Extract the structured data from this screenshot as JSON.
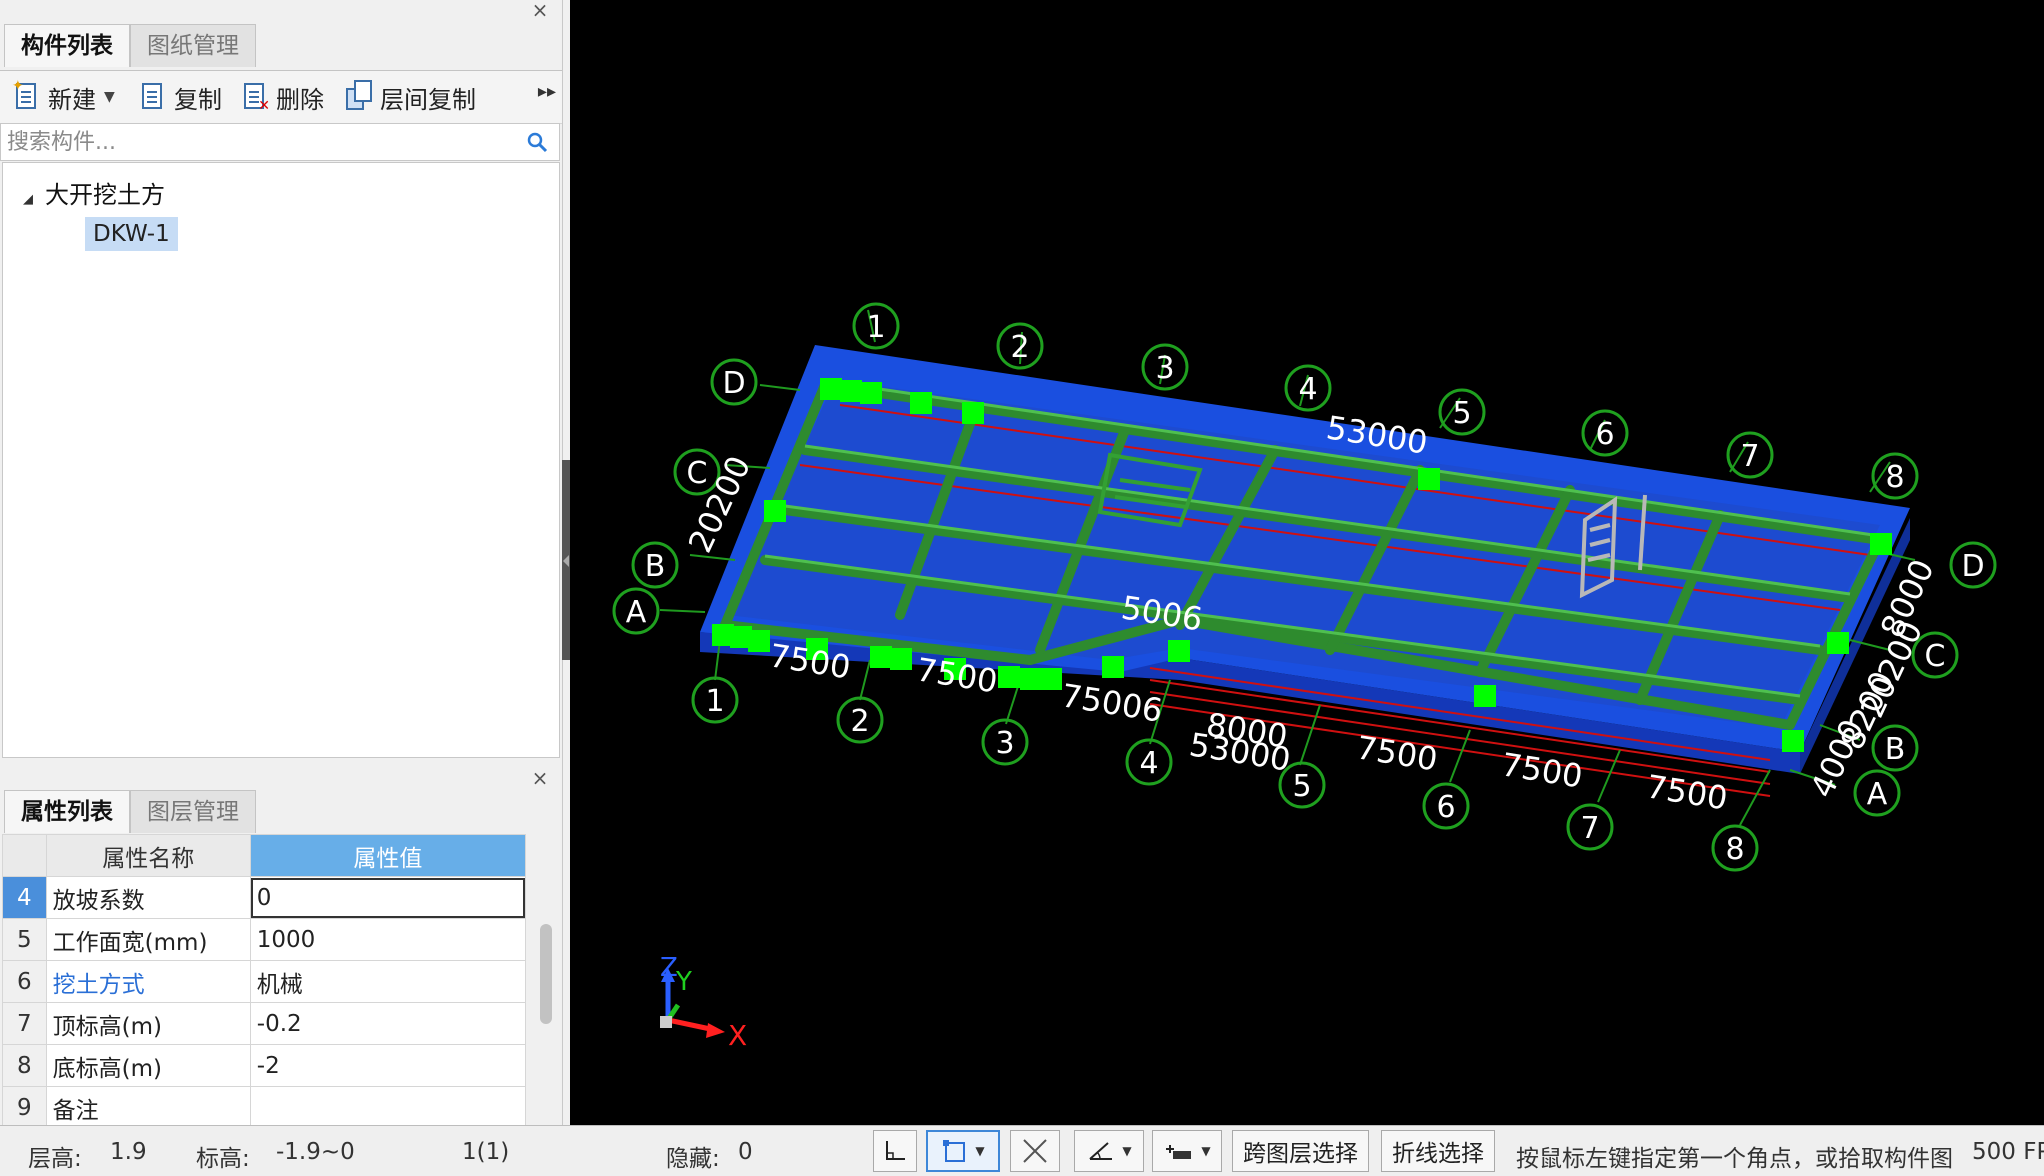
{
  "component_panel": {
    "tabs": [
      "构件列表",
      "图纸管理"
    ],
    "toolbar": {
      "new_label": "新建",
      "copy_label": "复制",
      "delete_label": "删除",
      "floor_copy_label": "层间复制",
      "more_icon": "double-chevron-right-icon"
    },
    "search_placeholder": "搜索构件...",
    "tree": {
      "group_label": "大开挖土方",
      "item_label": "DKW-1"
    }
  },
  "property_panel": {
    "tabs": [
      "属性列表",
      "图层管理"
    ],
    "headers": {
      "name": "属性名称",
      "value": "属性值"
    },
    "rows": [
      {
        "num": "4",
        "name": "放坡系数",
        "value": "0"
      },
      {
        "num": "5",
        "name": "工作面宽(mm)",
        "value": "1000"
      },
      {
        "num": "6",
        "name": "挖土方式",
        "value": "机械"
      },
      {
        "num": "7",
        "name": "顶标高(m)",
        "value": "-0.2"
      },
      {
        "num": "8",
        "name": "底标高(m)",
        "value": "-2"
      },
      {
        "num": "9",
        "name": "备注",
        "value": ""
      }
    ]
  },
  "viewport": {
    "background": "#000000",
    "slab_color": "#1a4fe0",
    "beam_color": "#2e8b2e",
    "marker_color": "#00ff00",
    "axis_labels_top": [
      "1",
      "2",
      "3",
      "4",
      "5",
      "6",
      "7",
      "8"
    ],
    "axis_labels_left": [
      "D",
      "C",
      "B",
      "A"
    ],
    "axis_labels_right": [
      "D",
      "C",
      "B",
      "A"
    ],
    "dimension_labels": [
      "53000",
      "7500",
      "7500",
      "7500",
      "8000",
      "53000",
      "7500",
      "7500",
      "7500",
      "75006",
      "20200",
      "8000",
      "20200",
      "4000",
      "8200",
      "5006"
    ],
    "axis_gizmo": {
      "x": "X",
      "y": "Y",
      "z": "Z"
    }
  },
  "status_bar": {
    "floor_height_label": "层高:",
    "floor_height_value": "1.9",
    "elevation_label": "标高:",
    "elevation_value": "-1.9~0",
    "selection_count": "1(1)",
    "hidden_label": "隐藏:",
    "hidden_value": "0",
    "cross_layer_select": "跨图层选择",
    "polyline_select": "折线选择",
    "hint": "按鼠标左键指定第一个角点，或拾取构件图",
    "fps": "500 FP"
  }
}
